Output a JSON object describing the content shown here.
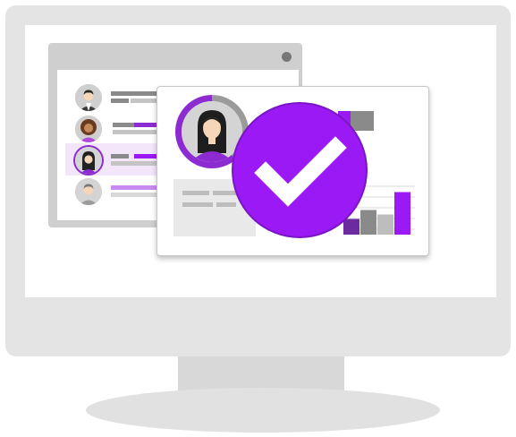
{
  "colors": {
    "accent": "#9b19f4",
    "accent_dark": "#8d2bd3",
    "bezel": "#e4e4e4",
    "bar_gray": "#8a8a8a",
    "bar_light_gray": "#c4c4c4"
  },
  "icons": {
    "monitor": "monitor-icon",
    "profile": "user-avatar-icon",
    "verified": "checkmark-icon",
    "chart": "bar-chart-icon"
  },
  "back_window": {
    "rows": [
      {
        "person": "man-in-suit",
        "selected": false
      },
      {
        "person": "woman-curly-hair",
        "selected": false
      },
      {
        "person": "woman-long-hair",
        "selected": true
      },
      {
        "person": "man-gray-hair",
        "selected": false
      }
    ]
  },
  "profile_card": {
    "person": "woman-long-hair",
    "status": "verified",
    "chart_bar_levels": [
      0.35,
      0.55,
      0.45,
      0.95
    ]
  }
}
